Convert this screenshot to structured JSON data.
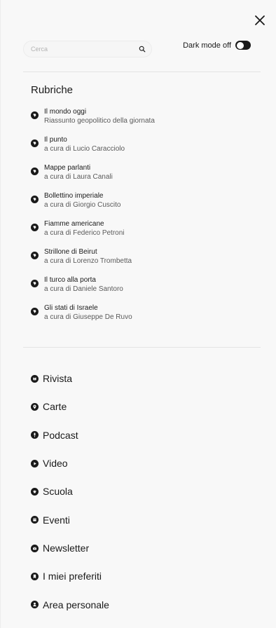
{
  "header": {
    "close_icon": "close-icon"
  },
  "search": {
    "placeholder": "Cerca",
    "value": "",
    "icon": "search-icon"
  },
  "dark_mode": {
    "label": "Dark mode off",
    "enabled": false
  },
  "rubriche": {
    "title": "Rubriche",
    "items": [
      {
        "title": "Il mondo oggi",
        "subtitle": "Riassunto geopolitico della giornata",
        "icon": "globe-icon"
      },
      {
        "title": "Il punto",
        "subtitle": "a cura di Lucio Caracciolo",
        "icon": "globe-icon"
      },
      {
        "title": "Mappe parlanti",
        "subtitle": "a cura di Laura Canali",
        "icon": "globe-icon"
      },
      {
        "title": "Bollettino imperiale",
        "subtitle": "a cura di Giorgio Cuscito",
        "icon": "globe-icon"
      },
      {
        "title": "Fiamme americane",
        "subtitle": "a cura di Federico Petroni",
        "icon": "globe-icon"
      },
      {
        "title": "Strillone di Beirut",
        "subtitle": "a cura di Lorenzo Trombetta",
        "icon": "globe-icon"
      },
      {
        "title": "Il turco alla porta",
        "subtitle": "a cura di Daniele Santoro",
        "icon": "globe-icon"
      },
      {
        "title": "Gli stati di Israele",
        "subtitle": "a cura di Giuseppe De Ruvo",
        "icon": "globe-icon"
      }
    ]
  },
  "nav": {
    "items": [
      {
        "label": "Rivista",
        "icon": "book-icon"
      },
      {
        "label": "Carte",
        "icon": "map-pin-icon"
      },
      {
        "label": "Podcast",
        "icon": "microphone-icon"
      },
      {
        "label": "Video",
        "icon": "play-icon"
      },
      {
        "label": "Scuola",
        "icon": "school-icon"
      },
      {
        "label": "Eventi",
        "icon": "calendar-icon"
      },
      {
        "label": "Newsletter",
        "icon": "mail-icon"
      },
      {
        "label": "I miei preferiti",
        "icon": "bookmark-icon"
      },
      {
        "label": "Area personale",
        "icon": "user-icon"
      }
    ]
  },
  "colors": {
    "background": "#f8f8f8",
    "text": "#1a1a1a",
    "subtext": "#5a5a5a",
    "toggle": "#1a1a1a"
  }
}
